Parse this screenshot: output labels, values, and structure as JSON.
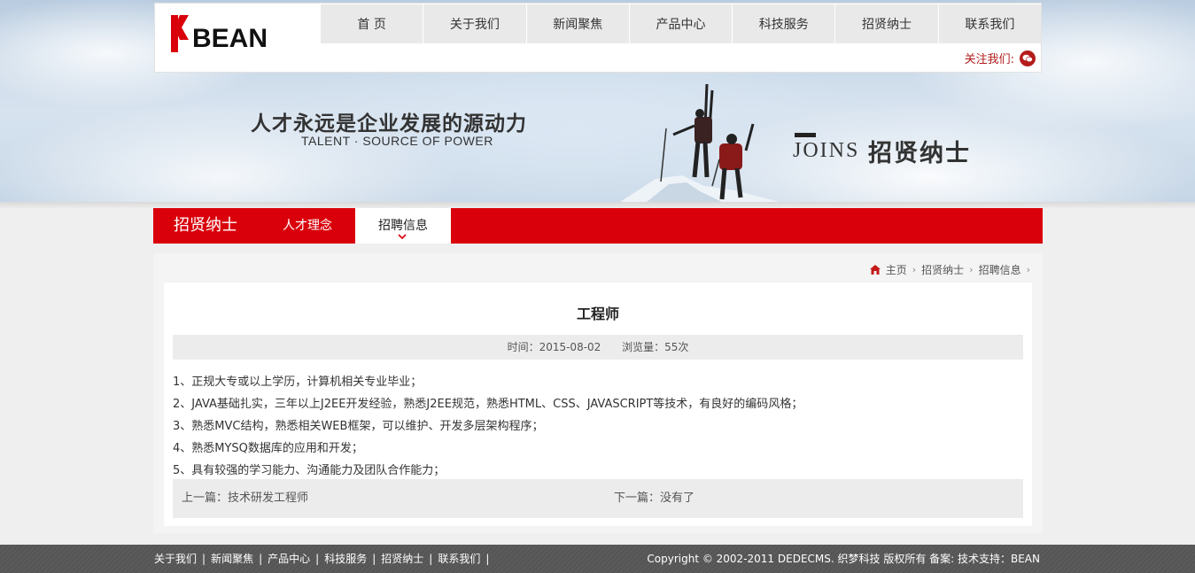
{
  "brand": {
    "logo_text": "BEAN"
  },
  "nav": [
    {
      "label": "首 页"
    },
    {
      "label": "关于我们"
    },
    {
      "label": "新闻聚焦"
    },
    {
      "label": "产品中心"
    },
    {
      "label": "科技服务"
    },
    {
      "label": "招贤纳士"
    },
    {
      "label": "联系我们"
    }
  ],
  "follow": {
    "label": "关注我们:",
    "icon": "wechat-icon"
  },
  "banner": {
    "slogan_cn": "人才永远是企业发展的源动力",
    "slogan_en": "TALENT · SOURCE OF POWER",
    "joins_en": "JOINS",
    "joins_cn": "招贤纳士"
  },
  "subnav": {
    "title": "招贤纳士",
    "items": [
      {
        "label": "人才理念"
      },
      {
        "label": "招聘信息",
        "active": true
      }
    ]
  },
  "breadcrumb": {
    "icon": "home-icon",
    "items": [
      "主页",
      "招贤纳士",
      "招聘信息"
    ]
  },
  "article": {
    "title": "工程师",
    "time": "时间：2015-08-02",
    "views": "浏览量：55次",
    "lines": [
      "1、正规大专或以上学历，计算机相关专业毕业；",
      "2、JAVA基础扎实，三年以上J2EE开发经验，熟悉J2EE规范，熟悉HTML、CSS、JAVASCRIPT等技术，有良好的编码风格；",
      "3、熟悉MVC结构，熟悉相关WEB框架，可以维护、开发多层架构程序；",
      "4、熟悉MYSQ数据库的应用和开发；",
      "5、具有较强的学习能力、沟通能力及团队合作能力；"
    ],
    "prev": "上一篇：技术研发工程师",
    "next": "下一篇：没有了"
  },
  "footer": {
    "links": [
      "关于我们",
      "新闻聚焦",
      "产品中心",
      "科技服务",
      "招贤纳士",
      "联系我们"
    ],
    "copyright": "Copyright © 2002-2011 DEDECMS. 织梦科技 版权所有 备案: 技术支持：BEAN"
  },
  "colors": {
    "brand_red": "#d9000b",
    "dark_red": "#b21b1b"
  }
}
